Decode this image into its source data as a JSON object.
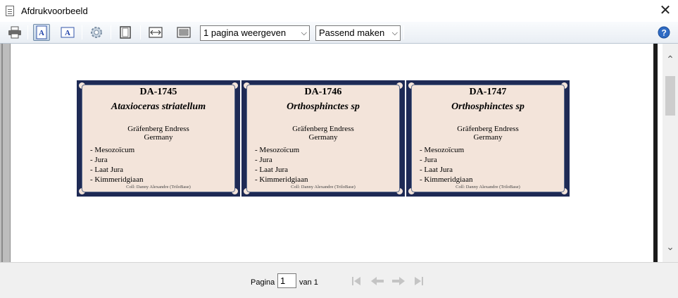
{
  "window": {
    "title": "Afdrukvoorbeeld",
    "close_glyph": "✕"
  },
  "toolbar": {
    "icons": [
      "printer-icon",
      "portrait-icon",
      "landscape-icon",
      "settings-icon",
      "page-icon",
      "fit-width-icon",
      "fit-page-icon",
      "help-icon"
    ],
    "pages_select": "1 pagina weergeven",
    "zoom_select": "Passend maken",
    "dropdown_glyph": "⌵"
  },
  "labels": [
    {
      "code": "DA-1745",
      "name": "Ataxioceras striatellum",
      "location": "Gräfenberg Endress",
      "country": "Germany",
      "strata": [
        "- Mesozoïcum",
        "- Jura",
        "- Laat Jura",
        "- Kimmeridgiaan"
      ],
      "collection": "Coll: Danny Alexandre (TriloBase)"
    },
    {
      "code": "DA-1746",
      "name": "Orthosphinctes sp",
      "location": "Gräfenberg Endress",
      "country": "Germany",
      "strata": [
        "- Mesozoïcum",
        "- Jura",
        "- Laat Jura",
        "- Kimmeridgiaan"
      ],
      "collection": "Coll: Danny Alexandre (TriloBase)"
    },
    {
      "code": "DA-1747",
      "name": "Orthosphinctes sp",
      "location": "Gräfenberg Endress",
      "country": "Germany",
      "strata": [
        "- Mesozoïcum",
        "- Jura",
        "- Laat Jura",
        "- Kimmeridgiaan"
      ],
      "collection": "Coll: Danny Alexandre (TriloBase)"
    }
  ],
  "label_colors": {
    "background": "#f3e4da",
    "border": "#1e2a55"
  },
  "footer": {
    "page_label": "Pagina",
    "page_value": "1",
    "page_of": "van 1",
    "nav_icons": [
      "first-page-icon",
      "previous-page-icon",
      "next-page-icon",
      "last-page-icon"
    ]
  },
  "scrollbar": {
    "up_glyph": "⌃",
    "down_glyph": "⌄"
  }
}
